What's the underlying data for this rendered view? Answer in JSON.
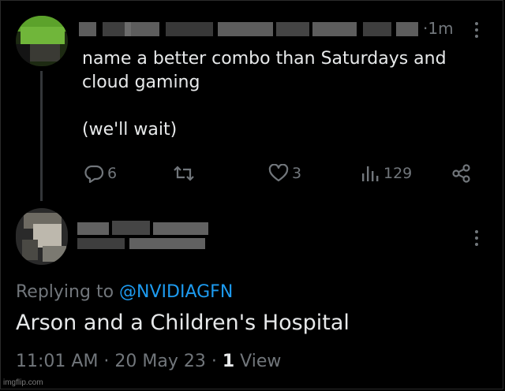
{
  "tweet": {
    "author_name": "",
    "time": "·1m",
    "text": "name a better combo than Saturdays and\ncloud gaming\n\n(we'll wait)",
    "actions": {
      "reply_count": "6",
      "retweet_count": "",
      "like_count": "3",
      "view_count": "129"
    }
  },
  "reply": {
    "replying_to_prefix": "Replying to ",
    "replying_to_handle": "@NVIDIAGFN",
    "text": "Arson and a Children's Hospital",
    "timestamp": "11:01 AM · 20 May 23 · ",
    "view_count": "1",
    "view_label": " View"
  },
  "watermark": "imgflip.com",
  "colors": {
    "background": "#000000",
    "text_primary": "#e7e9ea",
    "text_secondary": "#71767b",
    "link": "#1d9bf0"
  },
  "icons": [
    "reply-icon",
    "retweet-icon",
    "like-icon",
    "views-icon",
    "share-icon",
    "more-icon"
  ]
}
